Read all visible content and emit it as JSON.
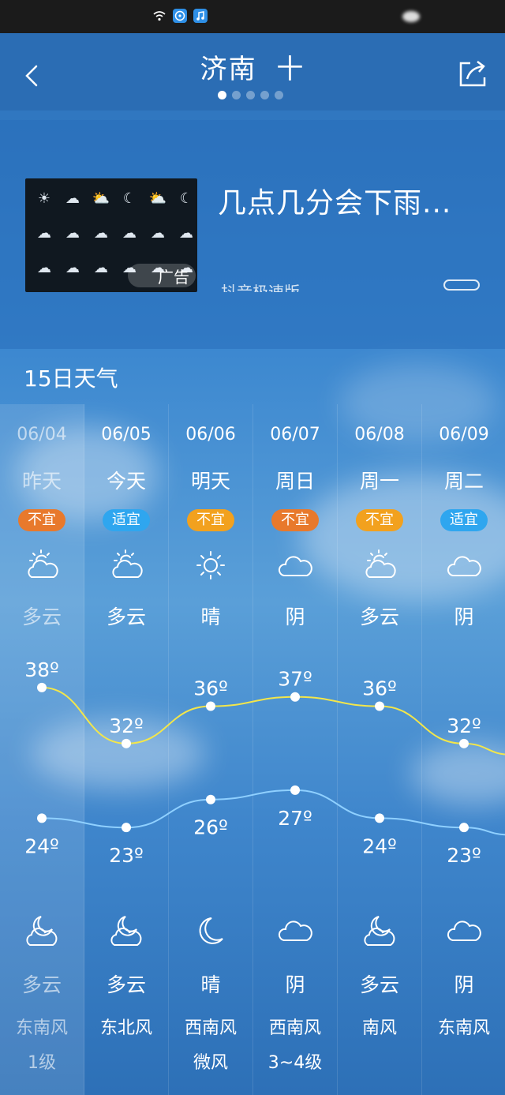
{
  "status_bar": {
    "icons": [
      "wifi-icon",
      "app-icon",
      "music-icon"
    ]
  },
  "header": {
    "city": "济南",
    "add_symbol": "十",
    "page_count": 5,
    "active_page": 0
  },
  "ad": {
    "title": "几点几分会下雨...",
    "subtitle": "抖音极速版",
    "badge": "广告"
  },
  "section_title": "15日天气",
  "days": [
    {
      "date": "06/04",
      "day": "昨天",
      "badge": "不宜",
      "badge_color": "#e8792c",
      "day_cond": "多云",
      "day_icon": "partly-cloudy-icon",
      "high": "38º",
      "low": "24º",
      "night_icon": "moon-cloud-icon",
      "night_cond": "多云",
      "wind": "东南风",
      "wind_level": "1级",
      "past": true
    },
    {
      "date": "06/05",
      "day": "今天",
      "badge": "适宜",
      "badge_color": "#2fa6ef",
      "day_cond": "多云",
      "day_icon": "partly-cloudy-icon",
      "high": "32º",
      "low": "23º",
      "night_icon": "moon-cloud-icon",
      "night_cond": "多云",
      "wind": "东北风",
      "wind_level": "",
      "past": false
    },
    {
      "date": "06/06",
      "day": "明天",
      "badge": "不宜",
      "badge_color": "#f2a11e",
      "day_cond": "晴",
      "day_icon": "sun-icon",
      "high": "36º",
      "low": "26º",
      "night_icon": "moon-icon",
      "night_cond": "晴",
      "wind": "西南风",
      "wind_level": "微风",
      "past": false
    },
    {
      "date": "06/07",
      "day": "周日",
      "badge": "不宜",
      "badge_color": "#e8792c",
      "day_cond": "阴",
      "day_icon": "cloud-icon",
      "high": "37º",
      "low": "27º",
      "night_icon": "cloud-icon",
      "night_cond": "阴",
      "wind": "西南风",
      "wind_level": "3~4级",
      "past": false
    },
    {
      "date": "06/08",
      "day": "周一",
      "badge": "不宜",
      "badge_color": "#f2a11e",
      "day_cond": "多云",
      "day_icon": "partly-cloudy-icon",
      "high": "36º",
      "low": "24º",
      "night_icon": "moon-cloud-icon",
      "night_cond": "多云",
      "wind": "南风",
      "wind_level": "",
      "past": false
    },
    {
      "date": "06/09",
      "day": "周二",
      "badge": "适宜",
      "badge_color": "#2fa6ef",
      "day_cond": "阴",
      "day_icon": "cloud-icon",
      "high": "32º",
      "low": "23º",
      "night_icon": "cloud-icon",
      "night_cond": "阴",
      "wind": "东南风",
      "wind_level": "",
      "past": false
    }
  ],
  "chart_data": {
    "type": "line",
    "categories": [
      "06/04",
      "06/05",
      "06/06",
      "06/07",
      "06/08",
      "06/09"
    ],
    "series": [
      {
        "values": [
          38,
          32,
          36,
          37,
          36,
          32
        ],
        "color": "#f3e64a"
      },
      {
        "values": [
          24,
          23,
          26,
          27,
          24,
          23
        ],
        "color": "#8fd0ff"
      }
    ]
  }
}
